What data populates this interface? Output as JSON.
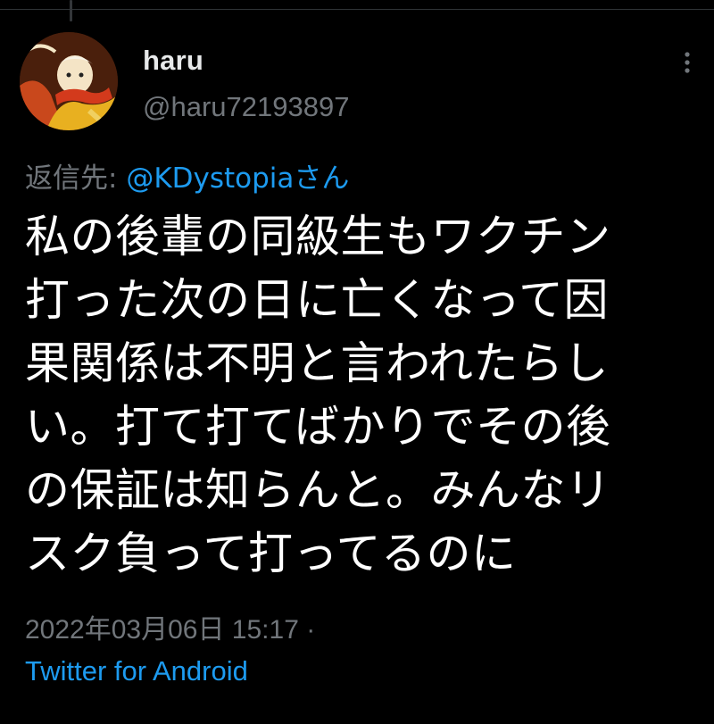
{
  "tweet": {
    "display_name": "haru",
    "handle": "@haru72193897",
    "reply_prefix": "返信先: ",
    "reply_to": "@KDystopiaさん",
    "text_lines": [
      "私の後輩の同級生もワクチン",
      "打った次の日に亡くなって因",
      "果関係は不明と言われたらし",
      "い。打て打てばかりでその後",
      "の保証は知らんと。みんなリ",
      "スク負って打ってるのに"
    ],
    "timestamp": "2022年03月06日 15:17",
    "timestamp_separator": " ·",
    "source": "Twitter for Android"
  },
  "icons": {
    "avatar": "anime-character-avatar",
    "more": "more-vertical-icon"
  },
  "colors": {
    "background": "#000000",
    "text_primary": "#ffffff",
    "text_secondary": "#71767b",
    "link": "#1d9bf0"
  }
}
